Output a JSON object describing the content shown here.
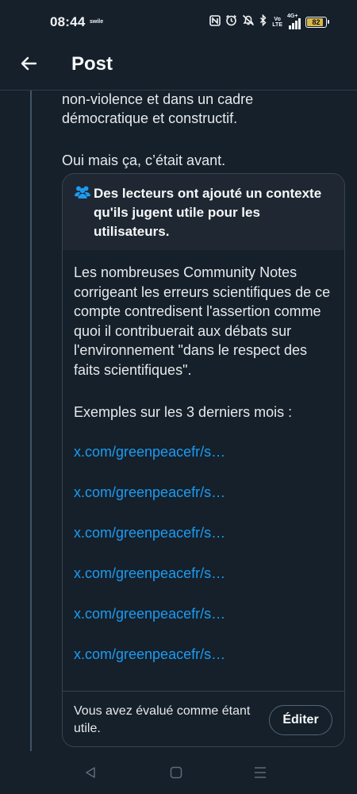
{
  "status_bar": {
    "time": "08:44",
    "carrier": "swile",
    "volte": [
      "Vo",
      "LTE"
    ],
    "network": "4G+",
    "battery": "82",
    "icons": [
      "nfc-icon",
      "alarm-icon",
      "mute-icon",
      "bluetooth-icon",
      "volte-icon",
      "signal-icon",
      "battery-icon"
    ]
  },
  "header": {
    "title": "Post",
    "back_icon": "arrow-left-icon"
  },
  "post": {
    "lines": [
      "non-violence et dans un cadre",
      "démocratique et constructif."
    ],
    "line_after_gap": "Oui mais ça, c’était avant."
  },
  "community_note": {
    "header_icon": "people-icon",
    "header_text": "Des lecteurs ont ajouté un contexte qu'ils jugent utile pour les utilisateurs.",
    "body": "Les nombreuses Community Notes corrigeant les erreurs scientifiques de ce compte contredisent l'assertion comme quoi il contribuerait aux débats sur l'environnement \"dans le respect des faits scientifiques\".",
    "examples_label": "Exemples sur les 3 derniers mois :",
    "links": [
      "x.com/greenpeacefr/s…",
      "x.com/greenpeacefr/s…",
      "x.com/greenpeacefr/s…",
      "x.com/greenpeacefr/s…",
      "x.com/greenpeacefr/s…",
      "x.com/greenpeacefr/s…"
    ],
    "rated_text": "Vous avez évalué comme étant utile.",
    "edit_label": "Éditer"
  },
  "colors": {
    "background": "#15202b",
    "note_header_bg": "#1e2732",
    "link": "#1d9bf0",
    "note_icon": "#1d9bf0",
    "battery": "#d9b64a"
  },
  "nav": {
    "back": "nav-back-icon",
    "home": "nav-home-icon",
    "recents": "nav-recents-icon"
  }
}
